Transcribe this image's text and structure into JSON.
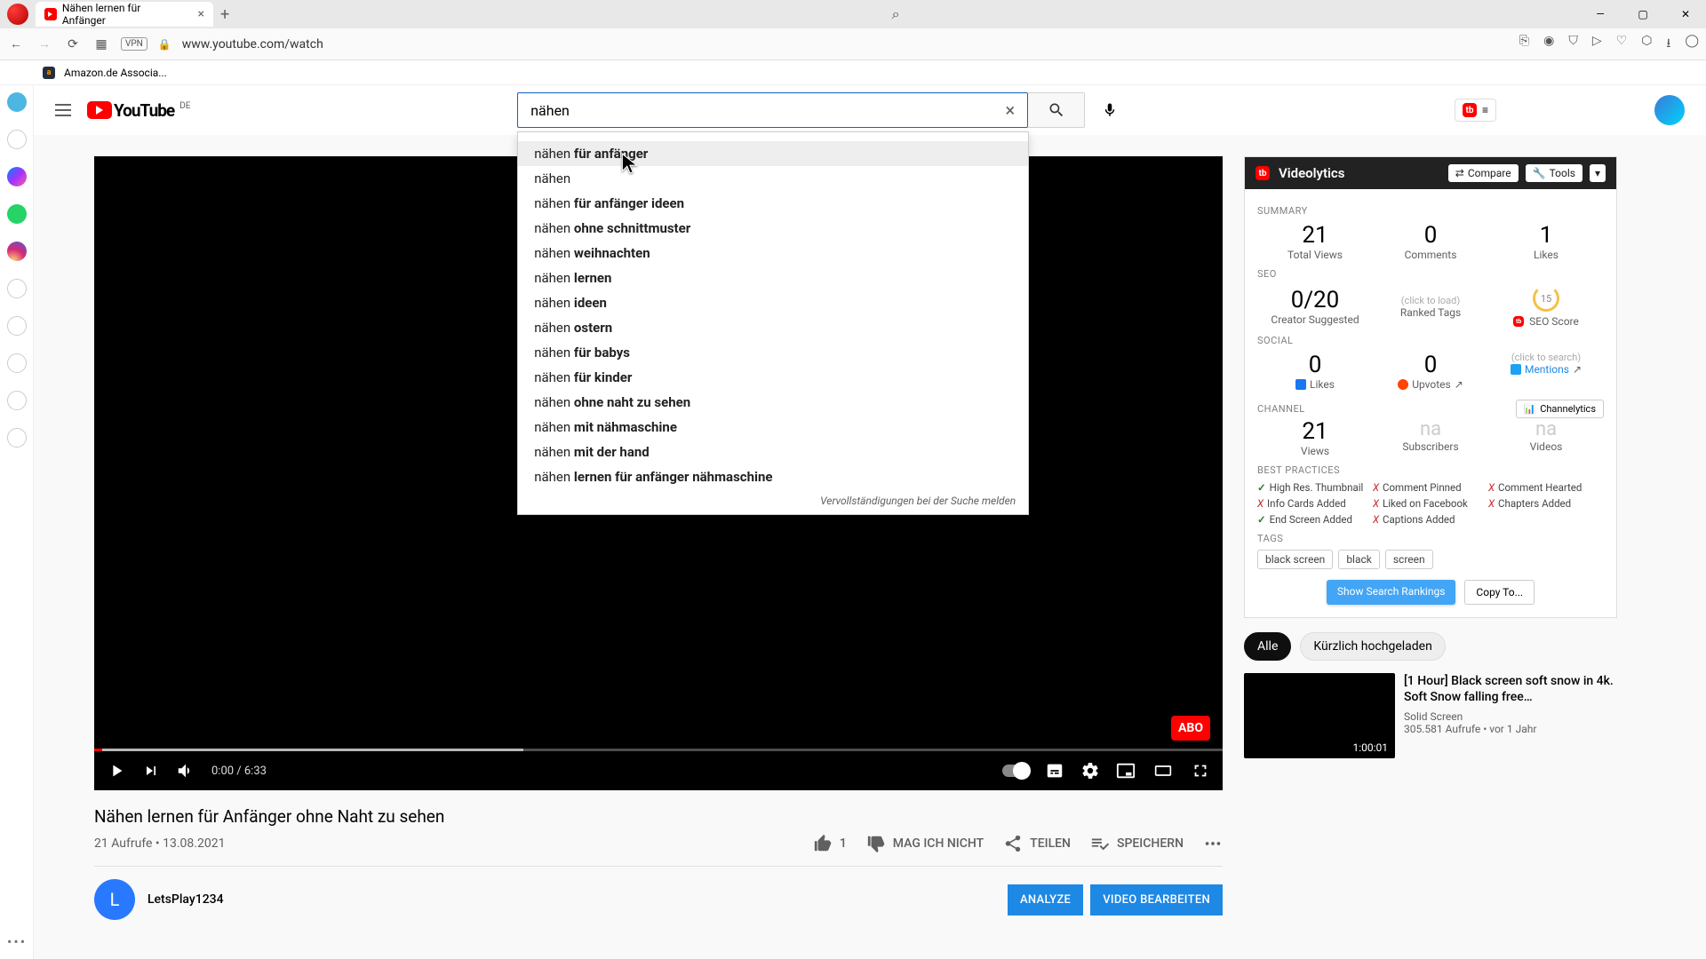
{
  "browser": {
    "tab_title": "Nähen lernen für Anfänger",
    "url": "www.youtube.com/watch",
    "vpn": "VPN",
    "bookmark": "Amazon.de Associa..."
  },
  "yt": {
    "logo_text": "YouTube",
    "region": "DE",
    "search_value": "nähen",
    "suggestions": [
      {
        "pre": "nähen ",
        "bold": "für anfänger"
      },
      {
        "pre": "nähen",
        "bold": ""
      },
      {
        "pre": "nähen ",
        "bold": "für anfänger ideen"
      },
      {
        "pre": "nähen ",
        "bold": "ohne schnittmuster"
      },
      {
        "pre": "nähen ",
        "bold": "weihnachten"
      },
      {
        "pre": "nähen ",
        "bold": "lernen"
      },
      {
        "pre": "nähen ",
        "bold": "ideen"
      },
      {
        "pre": "nähen ",
        "bold": "ostern"
      },
      {
        "pre": "nähen ",
        "bold": "für babys"
      },
      {
        "pre": "nähen ",
        "bold": "für kinder"
      },
      {
        "pre": "nähen ",
        "bold": "ohne naht zu sehen"
      },
      {
        "pre": "nähen ",
        "bold": "mit nähmaschine"
      },
      {
        "pre": "nähen ",
        "bold": "mit der hand"
      },
      {
        "pre": "nähen ",
        "bold": "lernen für anfänger nähmaschine"
      }
    ],
    "suggest_footer": "Vervollständigungen bei der Suche melden"
  },
  "player": {
    "time": "0:00 / 6:33",
    "abo": "ABO"
  },
  "video": {
    "title": "Nähen lernen für Anfänger ohne Naht zu sehen",
    "views_date": "21 Aufrufe • 13.08.2021",
    "like_count": "1",
    "dislike_label": "MAG ICH NICHT",
    "share_label": "TEILEN",
    "save_label": "SPEICHERN",
    "channel_initial": "L",
    "channel_name": "LetsPlay1234",
    "btn_analyze": "ANALYZE",
    "btn_edit": "VIDEO BEARBEITEN"
  },
  "vl": {
    "title": "Videolytics",
    "compare": "Compare",
    "tools": "Tools",
    "sec_summary": "SUMMARY",
    "total_views": "21",
    "total_views_l": "Total Views",
    "comments": "0",
    "comments_l": "Comments",
    "likes": "1",
    "likes_l": "Likes",
    "sec_seo": "SEO",
    "seo_ratio": "0/20",
    "seo_ratio_l": "Creator Suggested",
    "click_load": "(click to load)",
    "ranked_l": "Ranked Tags",
    "seo_score_v": "15",
    "seo_score_l": "SEO Score",
    "sec_social": "SOCIAL",
    "s_likes": "0",
    "s_likes_l": "Likes",
    "s_up": "0",
    "s_up_l": "Upvotes",
    "click_search": "(click to search)",
    "mentions": "Mentions",
    "sec_channel": "CHANNEL",
    "channelytics": "Channelytics",
    "c_views": "21",
    "c_views_l": "Views",
    "c_subs": "na",
    "c_subs_l": "Subscribers",
    "c_videos": "na",
    "c_videos_l": "Videos",
    "sec_bp": "BEST PRACTICES",
    "bp": [
      {
        "ok": true,
        "t": "High Res. Thumbnail"
      },
      {
        "ok": false,
        "t": "Comment Pinned"
      },
      {
        "ok": false,
        "t": "Comment Hearted"
      },
      {
        "ok": false,
        "t": "Info Cards Added"
      },
      {
        "ok": false,
        "t": "Liked on Facebook"
      },
      {
        "ok": false,
        "t": "Chapters Added"
      },
      {
        "ok": true,
        "t": "End Screen Added"
      },
      {
        "ok": false,
        "t": "Captions Added"
      }
    ],
    "sec_tags": "TAGS",
    "tags": [
      "black screen",
      "black",
      "screen"
    ],
    "show_rank": "Show Search Rankings",
    "copy_to": "Copy To..."
  },
  "chips": {
    "all": "Alle",
    "recent": "Kürzlich hochgeladen"
  },
  "rel": {
    "title": "[1 Hour] Black screen soft snow in 4k. Soft Snow falling free…",
    "channel": "Solid Screen",
    "meta": "305.581 Aufrufe • vor 1 Jahr",
    "dur": "1:00:01"
  }
}
